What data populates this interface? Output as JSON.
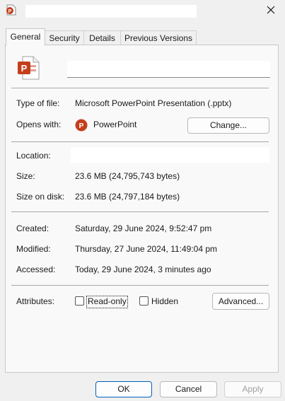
{
  "tabs": [
    {
      "label": "General",
      "active": true
    },
    {
      "label": "Security",
      "active": false
    },
    {
      "label": "Details",
      "active": false
    },
    {
      "label": "Previous Versions",
      "active": false
    }
  ],
  "icons": {
    "title": "powerpoint-file-icon",
    "close": "close-icon",
    "app": "powerpoint-app-icon"
  },
  "colors": {
    "accent": "#005fb8",
    "powerpoint": "#c43e1c"
  },
  "file": {
    "type_label": "Type of file:",
    "type_value": "Microsoft PowerPoint Presentation (.pptx)",
    "opens_label": "Opens with:",
    "opens_value": "PowerPoint",
    "change_label": "Change..."
  },
  "location": {
    "label": "Location:"
  },
  "size": {
    "label": "Size:",
    "value": "23.6 MB (24,795,743 bytes)",
    "disk_label": "Size on disk:",
    "disk_value": "23.6 MB (24,797,184 bytes)"
  },
  "dates": {
    "created_label": "Created:",
    "created_value": "Saturday, 29 June 2024, 9:52:47 pm",
    "modified_label": "Modified:",
    "modified_value": "Thursday, 27 June 2024, 11:49:04 pm",
    "accessed_label": "Accessed:",
    "accessed_value": "Today, 29 June 2024, 3 minutes ago"
  },
  "attributes": {
    "label": "Attributes:",
    "readonly_label": "Read-only",
    "readonly_checked": false,
    "hidden_label": "Hidden",
    "hidden_checked": false,
    "advanced_label": "Advanced..."
  },
  "footer": {
    "ok_label": "OK",
    "cancel_label": "Cancel",
    "apply_label": "Apply"
  }
}
